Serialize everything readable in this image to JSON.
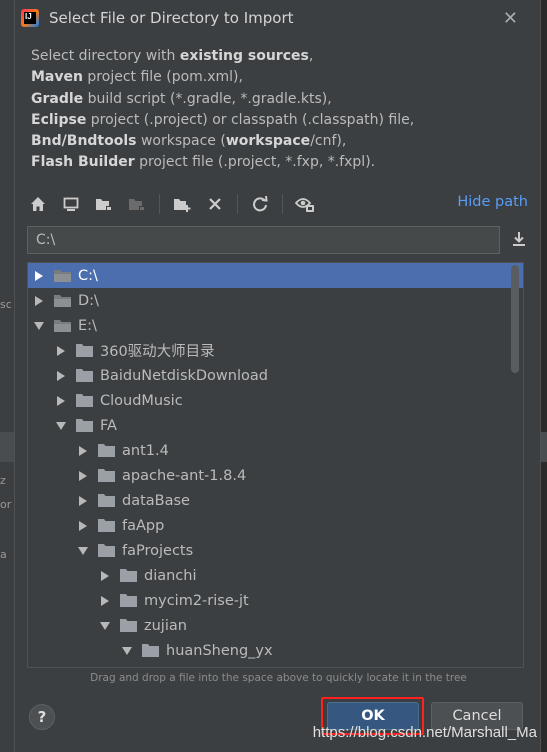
{
  "dialog": {
    "title": "Select File or Directory to Import",
    "app_icon_text": "IJ"
  },
  "description": {
    "line1_pre": "Select directory with ",
    "line1_bold": "existing sources",
    "line1_post": ",",
    "line2_bold": "Maven",
    "line2_post": " project file (pom.xml),",
    "line3_bold": "Gradle",
    "line3_post": " build script (*.gradle, *.gradle.kts),",
    "line4_bold": "Eclipse",
    "line4_post": " project (.project) or classpath (.classpath) file,",
    "line5_bold": "Bnd/Bndtools",
    "line5_mid": " workspace (",
    "line5_bold2": "workspace",
    "line5_post": "/cnf),",
    "line6_bold": "Flash Builder",
    "line6_post": " project file (.project, *.fxp, *.fxpl)."
  },
  "toolbar": {
    "hide_path_label": "Hide path"
  },
  "path": {
    "value": "C:\\"
  },
  "tree": {
    "items": [
      {
        "label": "C:\\",
        "depth": 0,
        "expanded": false,
        "type": "drive",
        "selected": true
      },
      {
        "label": "D:\\",
        "depth": 0,
        "expanded": false,
        "type": "drive",
        "selected": false
      },
      {
        "label": "E:\\",
        "depth": 0,
        "expanded": true,
        "type": "drive",
        "selected": false
      },
      {
        "label": "360驱动大师目录",
        "depth": 1,
        "expanded": false,
        "type": "folder",
        "selected": false
      },
      {
        "label": "BaiduNetdiskDownload",
        "depth": 1,
        "expanded": false,
        "type": "folder",
        "selected": false
      },
      {
        "label": "CloudMusic",
        "depth": 1,
        "expanded": false,
        "type": "folder",
        "selected": false
      },
      {
        "label": "FA",
        "depth": 1,
        "expanded": true,
        "type": "folder",
        "selected": false
      },
      {
        "label": "ant1.4",
        "depth": 2,
        "expanded": false,
        "type": "folder",
        "selected": false
      },
      {
        "label": "apache-ant-1.8.4",
        "depth": 2,
        "expanded": false,
        "type": "folder",
        "selected": false
      },
      {
        "label": "dataBase",
        "depth": 2,
        "expanded": false,
        "type": "folder",
        "selected": false
      },
      {
        "label": "faApp",
        "depth": 2,
        "expanded": false,
        "type": "folder",
        "selected": false
      },
      {
        "label": "faProjects",
        "depth": 2,
        "expanded": true,
        "type": "folder",
        "selected": false
      },
      {
        "label": "dianchi",
        "depth": 3,
        "expanded": false,
        "type": "folder",
        "selected": false
      },
      {
        "label": "mycim2-rise-jt",
        "depth": 3,
        "expanded": false,
        "type": "folder",
        "selected": false
      },
      {
        "label": "zujian",
        "depth": 3,
        "expanded": true,
        "type": "folder",
        "selected": false
      },
      {
        "label": "huanSheng_yx",
        "depth": 4,
        "expanded": true,
        "type": "folder",
        "selected": false
      }
    ]
  },
  "hint": "Drag and drop a file into the space above to quickly locate it in the tree",
  "buttons": {
    "help_label": "?",
    "ok_label": "OK",
    "cancel_label": "Cancel"
  },
  "watermark": "https://blog.csdn.net/Marshall_Ma",
  "background_fragments": [
    "sc",
    "z",
    "or",
    "a"
  ],
  "colors": {
    "accent": "#589df6",
    "selection": "#4b6eaf",
    "ok_button": "#365880",
    "highlight_box": "#ff2020"
  }
}
